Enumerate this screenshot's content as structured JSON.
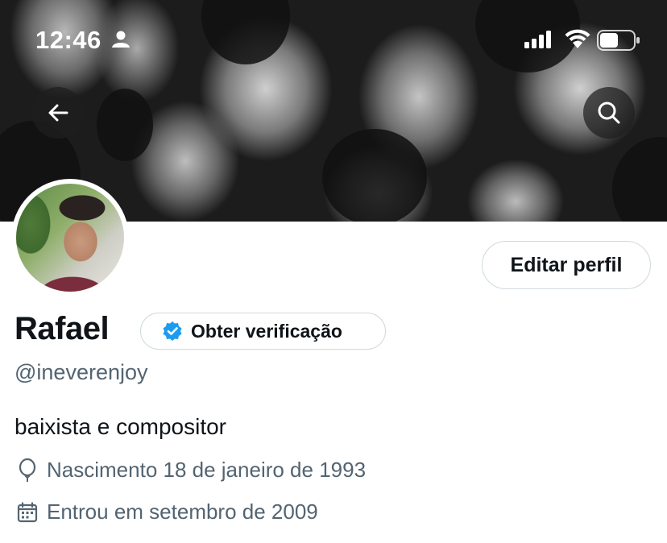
{
  "status_bar": {
    "time": "12:46"
  },
  "profile": {
    "name": "Rafael",
    "handle": "@ineverenjoy",
    "bio": "baixista e compositor",
    "edit_label": "Editar perfil",
    "verify_label": "Obter verificação",
    "birth_text": "Nascimento 18 de janeiro de 1993",
    "joined_text": "Entrou em setembro de 2009"
  },
  "icons": {
    "back": "arrow-left-icon",
    "search": "search-icon",
    "birth": "balloon-icon",
    "joined": "calendar-icon",
    "verified": "verified-badge-icon"
  },
  "colors": {
    "verified_blue": "#1d9bf0",
    "secondary_text": "#536471",
    "primary_text": "#0f1419",
    "border": "#cfd9de"
  }
}
